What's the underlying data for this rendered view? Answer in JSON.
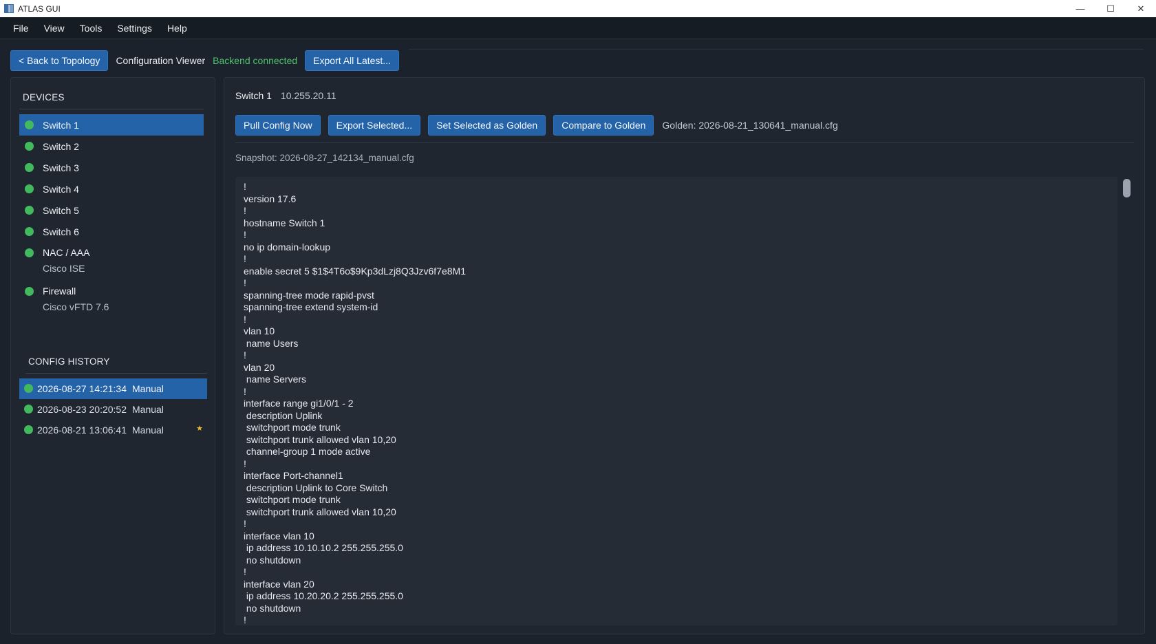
{
  "window": {
    "title": "ATLAS GUI",
    "controls": {
      "minimize": "—",
      "maximize": "☐",
      "close": "✕"
    }
  },
  "menu": [
    "File",
    "View",
    "Tools",
    "Settings",
    "Help"
  ],
  "toolbar": {
    "back_label": "< Back to Topology",
    "view_title": "Configuration Viewer",
    "backend_status": "Backend connected",
    "export_all_label": "Export All Latest..."
  },
  "sidebar": {
    "devices_title": "DEVICES",
    "devices": [
      {
        "name": "Switch 1",
        "sub": "",
        "status_color": "#43b95e"
      },
      {
        "name": "Switch 2",
        "sub": "",
        "status_color": "#43b95e"
      },
      {
        "name": "Switch 3",
        "sub": "",
        "status_color": "#43b95e"
      },
      {
        "name": "Switch 4",
        "sub": "",
        "status_color": "#43b95e"
      },
      {
        "name": "Switch 5",
        "sub": "",
        "status_color": "#43b95e"
      },
      {
        "name": "Switch 6",
        "sub": "",
        "status_color": "#43b95e"
      },
      {
        "name": "NAC / AAA",
        "sub": "Cisco ISE",
        "status_color": "#43b95e"
      },
      {
        "name": "Firewall",
        "sub": "Cisco vFTD 7.6",
        "status_color": "#43b95e"
      }
    ],
    "history_title": "CONFIG HISTORY",
    "history": [
      {
        "timestamp": "2026-08-27 14:21:34",
        "kind": "Manual",
        "golden": false
      },
      {
        "timestamp": "2026-08-23 20:20:52",
        "kind": "Manual",
        "golden": false
      },
      {
        "timestamp": "2026-08-21 13:06:41",
        "kind": "Manual",
        "golden": true,
        "golden_mark": "★"
      }
    ]
  },
  "main": {
    "device_name": "Switch 1",
    "device_ip": "10.255.20.11",
    "actions": {
      "pull": "Pull Config Now",
      "export_selected": "Export Selected...",
      "set_golden": "Set Selected as Golden",
      "compare": "Compare to Golden"
    },
    "golden_label": "Golden: 2026-08-21_130641_manual.cfg",
    "snapshot_label": "Snapshot: 2026-08-27_142134_manual.cfg",
    "config_text": "!\nversion 17.6\n!\nhostname Switch 1\n!\nno ip domain-lookup\n!\nenable secret 5 $1$4T6o$9Kp3dLzj8Q3Jzv6f7e8M1\n!\nspanning-tree mode rapid-pvst\nspanning-tree extend system-id\n!\nvlan 10\n name Users\n!\nvlan 20\n name Servers\n!\ninterface range gi1/0/1 - 2\n description Uplink\n switchport mode trunk\n switchport trunk allowed vlan 10,20\n channel-group 1 mode active\n!\ninterface Port-channel1\n description Uplink to Core Switch\n switchport mode trunk\n switchport trunk allowed vlan 10,20\n!\ninterface vlan 10\n ip address 10.10.10.2 255.255.255.0\n no shutdown\n!\ninterface vlan 20\n ip address 10.20.20.2 255.255.255.0\n no shutdown\n!\nend"
  },
  "colors": {
    "accent": "#2563a8",
    "status_ok": "#43b95e",
    "star": "#f0b62d"
  }
}
